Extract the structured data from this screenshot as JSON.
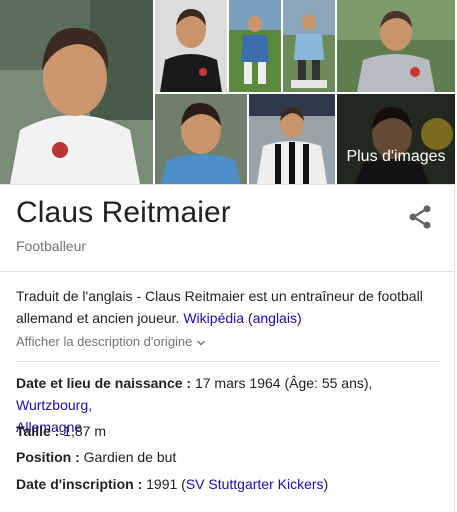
{
  "images": {
    "more_label": "Plus d'images",
    "captions": [
      "Claus Reitmaier portrait 1",
      "Claus Reitmaier portrait 2",
      "Claus Reitmaier portrait 3",
      "Claus Reitmaier portrait 4",
      "Claus Reitmaier portrait 5",
      "Claus Reitmaier portrait 6",
      "Claus Reitmaier portrait 7",
      "Claus Reitmaier portrait 8"
    ]
  },
  "entity": {
    "title": "Claus Reitmaier",
    "subtitle": "Footballeur"
  },
  "description": {
    "text": "Traduit de l'anglais - Claus Reitmaier est un entraîneur de football allemand et ancien joueur.",
    "source_link": "Wikipédia (anglais)",
    "original_toggle": "Afficher la description d'origine"
  },
  "facts": {
    "birth": {
      "label": "Date et lieu de naissance :",
      "value": "17 mars 1964 (Âge: 55 ans),",
      "place_link": "Wurtzbourg,",
      "country_link": "Allemagne"
    },
    "height": {
      "label": "Taille :",
      "value": "1,87 m"
    },
    "position": {
      "label": "Position :",
      "value": "Gardien de but"
    },
    "signup": {
      "label": "Date d'inscription :",
      "value": "1991 (",
      "club_link": "SV Stuttgarter Kickers",
      "suffix": ")"
    }
  },
  "colors": {
    "link": "#1a0dab",
    "muted": "#70757a",
    "divider": "#dfe1e5"
  }
}
